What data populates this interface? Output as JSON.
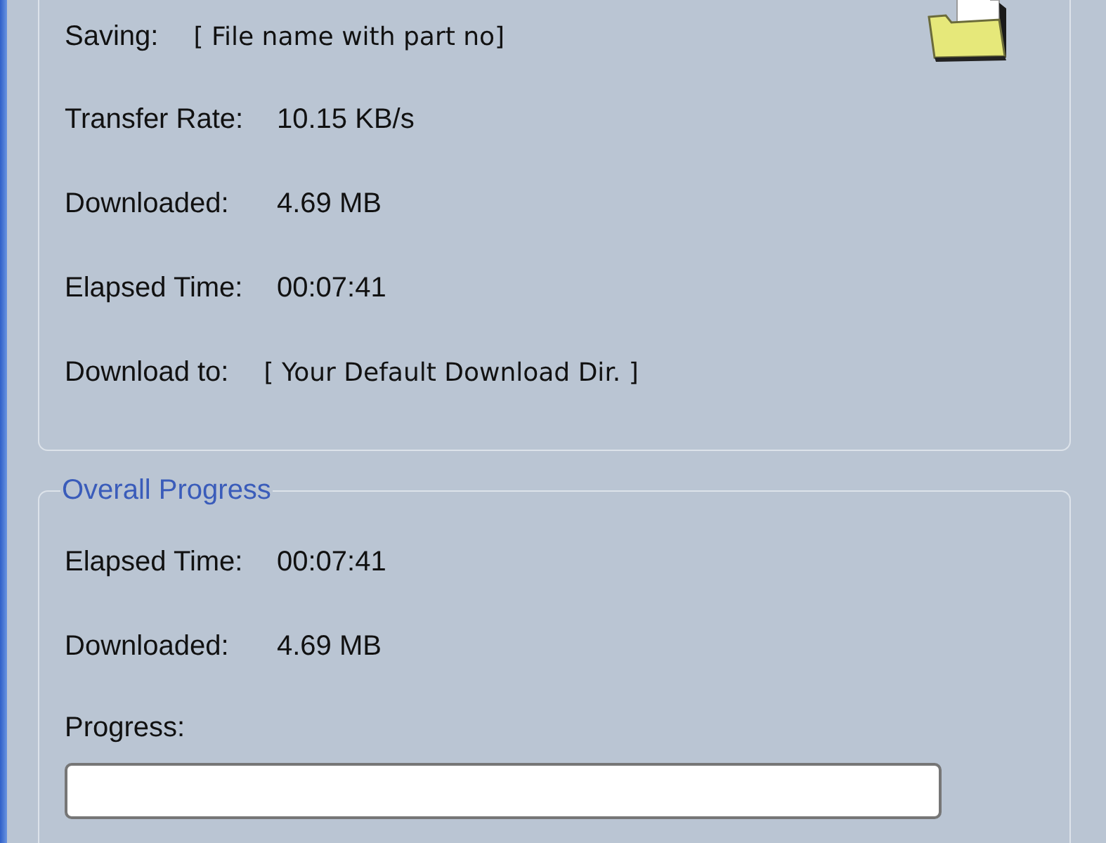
{
  "current_file": {
    "rows": [
      {
        "kind": "path",
        "label": "Saving:",
        "value": "[ File name with part no]"
      },
      {
        "kind": "stat",
        "label": "Transfer Rate:",
        "value": "10.15 KB/s"
      },
      {
        "kind": "stat",
        "label": "Downloaded:",
        "value": "4.69 MB"
      },
      {
        "kind": "stat",
        "label": "Elapsed Time:",
        "value": "00:07:41"
      },
      {
        "kind": "path",
        "label": "Download to:",
        "value": "[ Your Default Download Dir. ]"
      }
    ]
  },
  "overall_progress": {
    "title": "Overall Progress",
    "rows": [
      {
        "kind": "stat",
        "label": "Elapsed Time:",
        "value": "00:07:41"
      },
      {
        "kind": "stat",
        "label": "Downloaded:",
        "value": "4.69 MB"
      }
    ],
    "progress": {
      "label": "Progress:",
      "level": 0
    }
  }
}
